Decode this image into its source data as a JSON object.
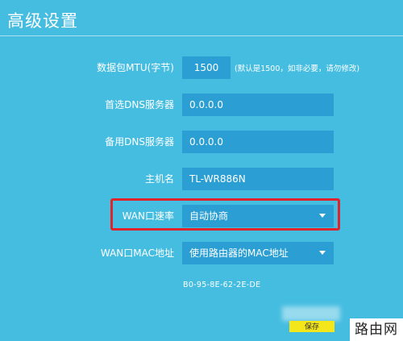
{
  "page": {
    "title": "高级设置"
  },
  "form": {
    "mtu": {
      "label": "数据包MTU(字节)",
      "value": "1500",
      "hint": "(默认是1500，如非必要，请勿修改)"
    },
    "dns_primary": {
      "label": "首选DNS服务器",
      "value": "0.0.0.0"
    },
    "dns_secondary": {
      "label": "备用DNS服务器",
      "value": "0.0.0.0"
    },
    "hostname": {
      "label": "主机名",
      "value": "TL-WR886N"
    },
    "wan_speed": {
      "label": "WAN口速率",
      "value": "自动协商"
    },
    "wan_mac": {
      "label": "WAN口MAC地址",
      "value": "使用路由器的MAC地址",
      "mac": "B0-95-8E-62-2E-DE"
    }
  },
  "actions": {
    "save_label": "保存"
  },
  "watermark": {
    "text": "路由网"
  },
  "colors": {
    "background": "#45bde1",
    "field": "#2b9fd3",
    "highlight": "#e0242c",
    "save": "#f3e61a"
  }
}
